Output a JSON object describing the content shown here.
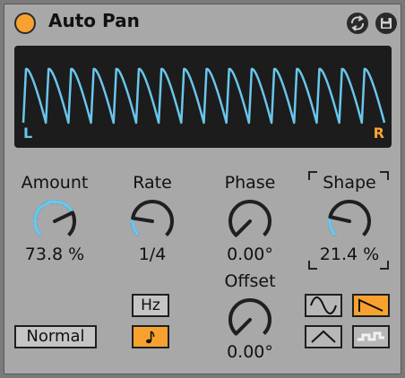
{
  "device": {
    "title": "Auto Pan",
    "power_icon": "power-icon",
    "hot_swap_icon": "hot-swap-icon",
    "save_icon": "save-icon"
  },
  "display": {
    "left_label": "L",
    "right_label": "R",
    "wave_color": "#69c6ec",
    "cycles": 16
  },
  "controls": {
    "amount": {
      "label": "Amount",
      "value": "73.8 %",
      "fraction": 0.738
    },
    "rate": {
      "label": "Rate",
      "value": "1/4",
      "fraction": 0.2
    },
    "phase": {
      "label": "Phase",
      "value": "0.00°",
      "fraction": 0.0
    },
    "shape": {
      "label": "Shape",
      "value": "21.4 %",
      "fraction": 0.214
    },
    "offset": {
      "label": "Offset",
      "value": "0.00°",
      "fraction": 0.0
    }
  },
  "buttons": {
    "mode": "Normal",
    "hz": "Hz",
    "sync_icon": "note-icon"
  },
  "waveforms": {
    "selected": "sawtooth-down",
    "options": [
      "sine",
      "sawtooth-down",
      "triangle",
      "random"
    ]
  },
  "colors": {
    "accent": "#f7a230",
    "wave": "#69c6ec",
    "panel": "#a8a8a8"
  }
}
